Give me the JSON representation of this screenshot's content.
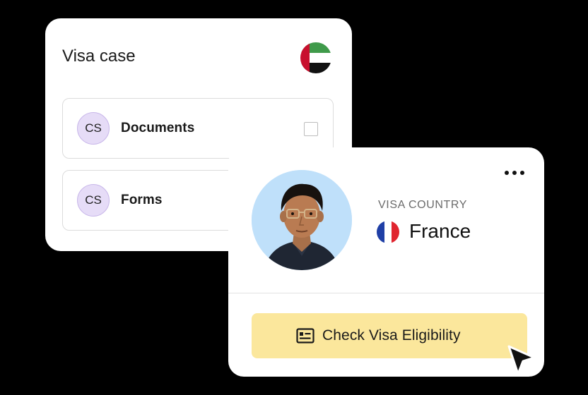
{
  "visa_case": {
    "title": "Visa case",
    "flag_icon": "uae-flag-icon",
    "rows": [
      {
        "avatar": "CS",
        "label": "Documents",
        "checkbox": "unchecked"
      },
      {
        "avatar": "CS",
        "label": "Forms"
      }
    ]
  },
  "visa_country_card": {
    "menu_icon": "more-horizontal-icon",
    "label": "VISA COUNTRY",
    "country": "France",
    "flag_icon": "france-flag-icon",
    "action_button": {
      "label": "Check Visa Eligibility",
      "icon": "id-card-icon"
    },
    "cursor_icon": "pointer-cursor-icon"
  },
  "colors": {
    "background": "#000000",
    "card": "#ffffff",
    "avatar_bg": "#e6dcf7",
    "button_bg": "#fbe79c",
    "label_gray": "#6b6b6b"
  }
}
